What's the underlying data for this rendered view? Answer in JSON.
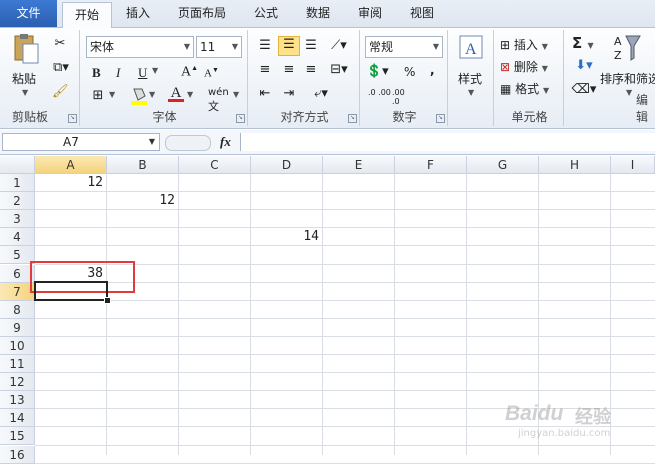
{
  "ribbon_tabs": [
    {
      "label": "文件"
    },
    {
      "label": "开始"
    },
    {
      "label": "插入"
    },
    {
      "label": "页面布局"
    },
    {
      "label": "公式"
    },
    {
      "label": "数据"
    },
    {
      "label": "审阅"
    },
    {
      "label": "视图"
    }
  ],
  "clipboard": {
    "paste_label": "粘贴",
    "group_label": "剪贴板"
  },
  "font": {
    "name": "宋体",
    "size": "11",
    "group_label": "字体",
    "bold": "B",
    "italic": "I",
    "underline": "U",
    "grow": "A",
    "shrink": "A",
    "phonetic": "wén"
  },
  "alignment": {
    "group_label": "对齐方式"
  },
  "number": {
    "format": "常规",
    "percent": "%",
    "comma": ",",
    "group_label": "数字",
    "inc_decimal": ".0 .00",
    "dec_decimal": ".00 .0"
  },
  "styles": {
    "label": "样式"
  },
  "cells": {
    "insert": "插入",
    "delete": "删除",
    "format": "格式",
    "group_label": "单元格"
  },
  "editing": {
    "sort_filter": "排序和筛选",
    "group_label": "编辑",
    "sum": "Σ"
  },
  "formula_bar": {
    "name_box": "A7",
    "fx": "fx",
    "value": ""
  },
  "colors": {
    "accent": "#2a5fb0",
    "fill_yellow": "#ffff00",
    "font_red": "#e02020",
    "highlight_red": "#e23b3b"
  },
  "columns": [
    "A",
    "B",
    "C",
    "D",
    "E",
    "F",
    "G",
    "H",
    "I"
  ],
  "rows": [
    "1",
    "2",
    "3",
    "4",
    "5",
    "6",
    "7",
    "8",
    "9",
    "10",
    "11",
    "12",
    "13",
    "14",
    "15",
    "16"
  ],
  "cell_values": [
    {
      "ref": "A1",
      "value": "12"
    },
    {
      "ref": "B2",
      "value": "12"
    },
    {
      "ref": "D4",
      "value": "14"
    },
    {
      "ref": "A6",
      "value": "38"
    }
  ],
  "watermark": {
    "brand": "Baidu",
    "text": "经验",
    "url": "jingyan.baidu.com"
  }
}
